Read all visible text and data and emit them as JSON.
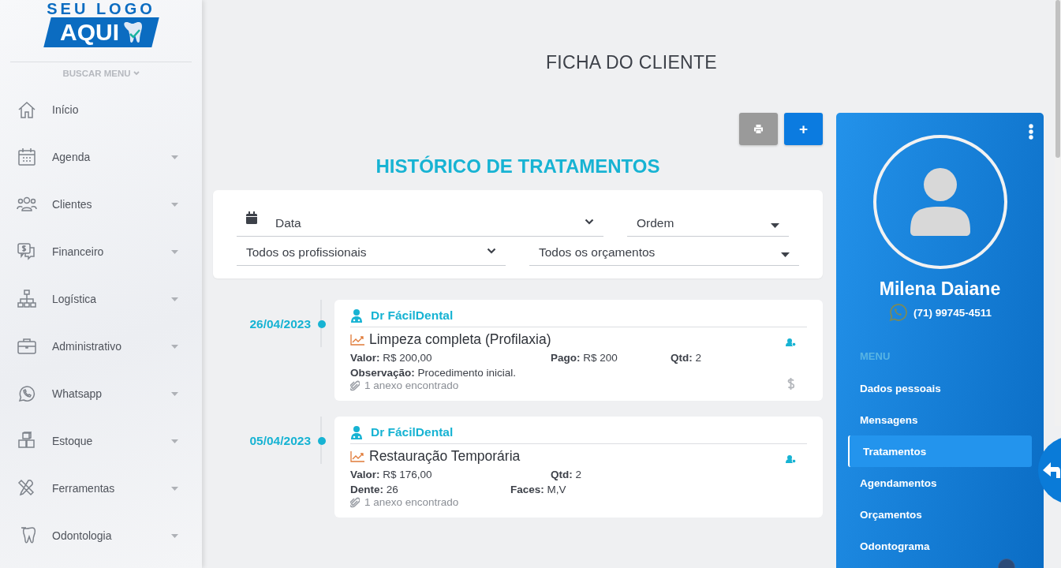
{
  "logo": {
    "top": "SEU LOGO",
    "bottom": "AQUI"
  },
  "sidebar": {
    "search": "BUSCAR MENU",
    "items": [
      {
        "kind": "home",
        "label": "Início",
        "expandable": false
      },
      {
        "kind": "calendar",
        "label": "Agenda",
        "expandable": true
      },
      {
        "kind": "people",
        "label": "Clientes",
        "expandable": true
      },
      {
        "kind": "money",
        "label": "Financeiro",
        "expandable": true
      },
      {
        "kind": "org",
        "label": "Logística",
        "expandable": true
      },
      {
        "kind": "briefcase",
        "label": "Administrativo",
        "expandable": true
      },
      {
        "kind": "whatsapp",
        "label": "Whatsapp",
        "expandable": true
      },
      {
        "kind": "boxes",
        "label": "Estoque",
        "expandable": true
      },
      {
        "kind": "tools",
        "label": "Ferramentas",
        "expandable": true
      },
      {
        "kind": "tooth",
        "label": "Odontologia",
        "expandable": true
      }
    ]
  },
  "page_title": "FICHA DO CLIENTE",
  "toolbar": {
    "add": "+"
  },
  "section_title": "HISTÓRICO DE TRATAMENTOS",
  "filters": [
    {
      "kind": "date",
      "label": "Data"
    },
    {
      "kind": "select",
      "label": "Ordem"
    },
    {
      "kind": "list",
      "label": "Todos os profissionais"
    },
    {
      "kind": "select",
      "label": "Todos os orçamentos"
    }
  ],
  "treatments": [
    {
      "date": "26/04/2023",
      "professional": "Dr FácilDental",
      "title": "Limpeza completa (Profilaxia)",
      "rows": [
        [
          {
            "label": "Valor:",
            "value": "R$ 200,00"
          },
          {
            "label": "Pago:",
            "value": "R$ 200"
          },
          {
            "label": "Qtd:",
            "value": "2"
          }
        ],
        [
          {
            "label": "Observação:",
            "value": "Procedimento inicial."
          }
        ]
      ],
      "attachments": "1 anexo encontrado",
      "paid": true
    },
    {
      "date": "05/04/2023",
      "professional": "Dr FácilDental",
      "title": "Restauração Temporária",
      "rows": [
        [
          {
            "label": "Valor:",
            "value": "R$ 176,00"
          },
          {
            "label": "Qtd:",
            "value": "2"
          }
        ],
        [
          {
            "label": "Dente:",
            "value": "26"
          },
          {
            "label": "Faces:",
            "value": "M,V"
          }
        ]
      ],
      "attachments": "1 anexo encontrado",
      "paid": false
    }
  ],
  "client": {
    "name": "Milena Daiane",
    "phone": "(71) 99745-4511",
    "menu_heading": "MENU",
    "menu": [
      {
        "label": "Dados pessoais",
        "selected": false
      },
      {
        "label": "Mensagens",
        "selected": false
      },
      {
        "label": "Tratamentos",
        "selected": true
      },
      {
        "label": "Agendamentos",
        "selected": false
      },
      {
        "label": "Orçamentos",
        "selected": false
      },
      {
        "label": "Odontograma",
        "selected": false
      }
    ]
  }
}
